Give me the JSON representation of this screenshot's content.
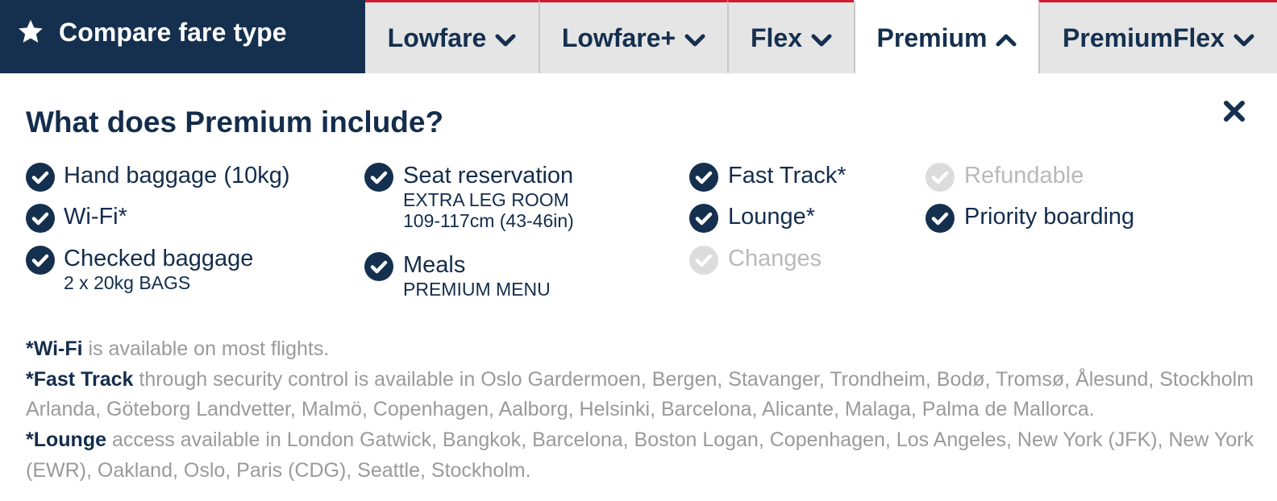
{
  "header": {
    "title": "Compare fare type",
    "tabs": [
      {
        "label": "Lowfare",
        "expanded": false
      },
      {
        "label": "Lowfare+",
        "expanded": false
      },
      {
        "label": "Flex",
        "expanded": false
      },
      {
        "label": "Premium",
        "expanded": true
      },
      {
        "label": "PremiumFlex",
        "expanded": false
      }
    ]
  },
  "panel": {
    "title": "What does Premium include?",
    "features": [
      {
        "label": "Hand baggage (10kg)",
        "included": true
      },
      {
        "label": "Wi-Fi*",
        "included": true
      },
      {
        "label": "Checked baggage",
        "sub": "2 x 20kg BAGS",
        "included": true
      },
      {
        "label": "Seat reservation",
        "sub1": "EXTRA LEG ROOM",
        "sub2": "109-117cm (43-46in)",
        "included": true
      },
      {
        "label": "Meals",
        "sub": "PREMIUM MENU",
        "included": true
      },
      {
        "label": "Fast Track*",
        "included": true
      },
      {
        "label": "Lounge*",
        "included": true
      },
      {
        "label": "Changes",
        "included": false
      },
      {
        "label": "Refundable",
        "included": false
      },
      {
        "label": "Priority boarding",
        "included": true
      }
    ]
  },
  "notes": [
    {
      "bold": "*Wi-Fi",
      "text": " is available on most flights."
    },
    {
      "bold": "*Fast Track",
      "text": " through security control is available in Oslo Gardermoen, Bergen, Stavanger, Trondheim, Bodø, Tromsø, Ålesund, Stockholm Arlanda, Göteborg Landvetter, Malmö, Copenhagen, Aalborg, Helsinki, Barcelona, Alicante, Malaga, Palma de Mallorca."
    },
    {
      "bold": "*Lounge",
      "text": " access available in London Gatwick, Bangkok, Barcelona, Boston Logan, Copenhagen, Los Angeles, New York (JFK), New York (EWR), Oakland, Oslo, Paris (CDG), Seattle, Stockholm."
    }
  ],
  "icons": {
    "star": "star-icon",
    "chevron_down": "chevron-down-icon",
    "chevron_up": "chevron-up-icon",
    "close": "close-icon",
    "check": "check-circle-icon"
  },
  "colors": {
    "navy": "#15304f",
    "accent_red": "#d11b2e",
    "tab_gray": "#e5e5e5",
    "disabled": "#d9d9d9",
    "muted_text": "#9a9a9a"
  }
}
